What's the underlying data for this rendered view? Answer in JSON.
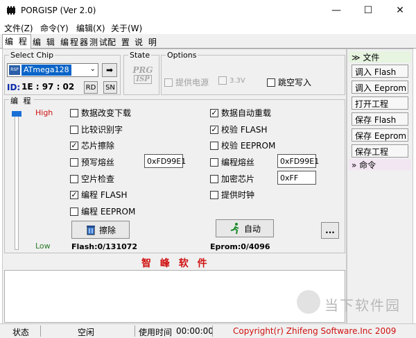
{
  "window": {
    "title": "PORGISP (Ver 2.0)",
    "min": "—",
    "max": "☐",
    "close": "✕"
  },
  "menu": [
    "文件(Z)",
    "命令(Y)",
    "编辑(X)",
    "关于(W)"
  ],
  "tabs": [
    "编 程",
    "编 辑",
    "编程器测试",
    "配 置",
    "说 明"
  ],
  "chip": {
    "group_label": "Select Chip",
    "chip_icon": "RSP",
    "selected": "ATmega128",
    "go_arrow": "➡",
    "id_label": "ID:",
    "id_value": "1E : 97 : 02",
    "rd": "RD",
    "sn": "SN"
  },
  "state": {
    "group_label": "State",
    "logo_top": "PRG",
    "logo_bottom": "ISP"
  },
  "options": {
    "group_label": "Options",
    "power": "提供电源",
    "v33": "3.3V",
    "jump": "跳空写入"
  },
  "program": {
    "group_label": "编 程",
    "high": "High",
    "low": "Low",
    "left_checks": [
      {
        "label": "数据改变下载",
        "checked": false
      },
      {
        "label": "比较识别字",
        "checked": false
      },
      {
        "label": "芯片擦除",
        "checked": true
      },
      {
        "label": "预写熔丝",
        "checked": false
      },
      {
        "label": "空片检查",
        "checked": false
      },
      {
        "label": "编程 FLASH",
        "checked": true
      },
      {
        "label": "编程 EEPROM",
        "checked": false
      }
    ],
    "right_checks": [
      {
        "label": "数据自动重载",
        "checked": true
      },
      {
        "label": "校验 FLASH",
        "checked": true
      },
      {
        "label": "校验 EEPROM",
        "checked": false
      },
      {
        "label": "编程熔丝",
        "checked": false
      },
      {
        "label": "加密芯片",
        "checked": false
      },
      {
        "label": "提供时钟",
        "checked": false
      }
    ],
    "fuse_left": "0xFD99E1",
    "fuse_right": "0xFD99E1",
    "lock": "0xFF",
    "erase_btn": "擦除",
    "auto_btn": "自动",
    "more_btn": "...",
    "flash": "Flash:0/131072",
    "eprom": "Eprom:0/4096",
    "company": "智 峰 软 件"
  },
  "rightpanel": {
    "file_head": "文件",
    "buttons": [
      "调入 Flash",
      "调入 Eeprom",
      "打开工程",
      "保存 Flash",
      "保存 Eeprom",
      "保存工程"
    ],
    "cmd_head": "命令"
  },
  "status": {
    "label": "状态",
    "value": "空闲",
    "time_label": "使用时间",
    "time": "00:00:00",
    "copyright": "Copyright(r) Zhifeng Software.Inc 2009"
  },
  "watermark": "当下软件园"
}
